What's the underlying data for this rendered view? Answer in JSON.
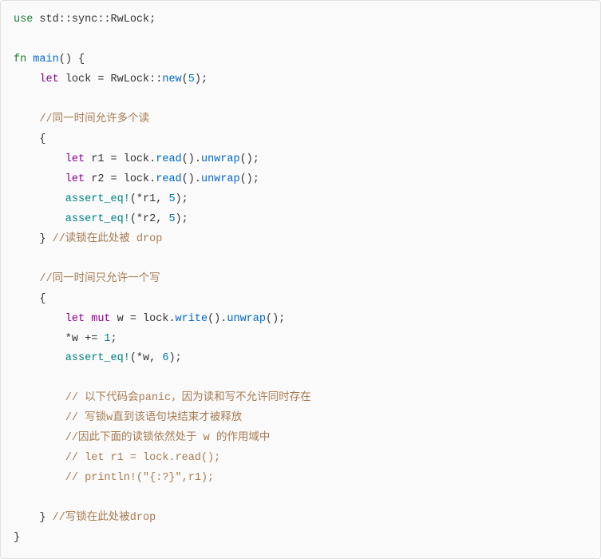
{
  "code": {
    "l1_use": "use",
    "l1_path": " std::sync::RwLock;",
    "l2_blank": "",
    "l3_fn": "fn",
    "l3_main": " main",
    "l3_rest": "() {",
    "l4_let": "    let",
    "l4_var": " lock = RwLock::",
    "l4_new": "new",
    "l4_paren_num": "(",
    "l4_num": "5",
    "l4_end": ");",
    "l5_blank": "",
    "l6_comment": "    //同一时间允许多个读",
    "l7_brace": "    {",
    "l8_let": "        let",
    "l8_rest": " r1 = lock.",
    "l8_read": "read",
    "l8_mid": "().",
    "l8_unwrap": "unwrap",
    "l8_end": "();",
    "l9_let": "        let",
    "l9_rest": " r2 = lock.",
    "l9_read": "read",
    "l9_mid": "().",
    "l9_unwrap": "unwrap",
    "l9_end": "();",
    "l10_macro": "        assert_eq!",
    "l10_rest": "(*r1, ",
    "l10_num": "5",
    "l10_end": ");",
    "l11_macro": "        assert_eq!",
    "l11_rest": "(*r2, ",
    "l11_num": "5",
    "l11_end": ");",
    "l12_brace": "    } ",
    "l12_comment": "//读锁在此处被 drop",
    "l13_blank": "",
    "l14_comment": "    //同一时间只允许一个写",
    "l15_brace": "    {",
    "l16_let": "        let",
    "l16_mut": " mut",
    "l16_rest": " w = lock.",
    "l16_write": "write",
    "l16_mid": "().",
    "l16_unwrap": "unwrap",
    "l16_end": "();",
    "l17_rest": "        *w += ",
    "l17_num": "1",
    "l17_end": ";",
    "l18_macro": "        assert_eq!",
    "l18_rest": "(*w, ",
    "l18_num": "6",
    "l18_end": ");",
    "l19_blank": "",
    "l20_comment": "        // 以下代码会panic，因为读和写不允许同时存在",
    "l21_comment": "        // 写锁w直到该语句块结束才被释放",
    "l22_comment": "        //因此下面的读锁依然处于 w 的作用域中",
    "l23_comment": "        // let r1 = lock.read();",
    "l24_comment": "        // println!(\"{:?}\",r1);",
    "l25_blank": "",
    "l26_brace": "    } ",
    "l26_comment": "//写锁在此处被drop",
    "l27_brace": "}"
  }
}
